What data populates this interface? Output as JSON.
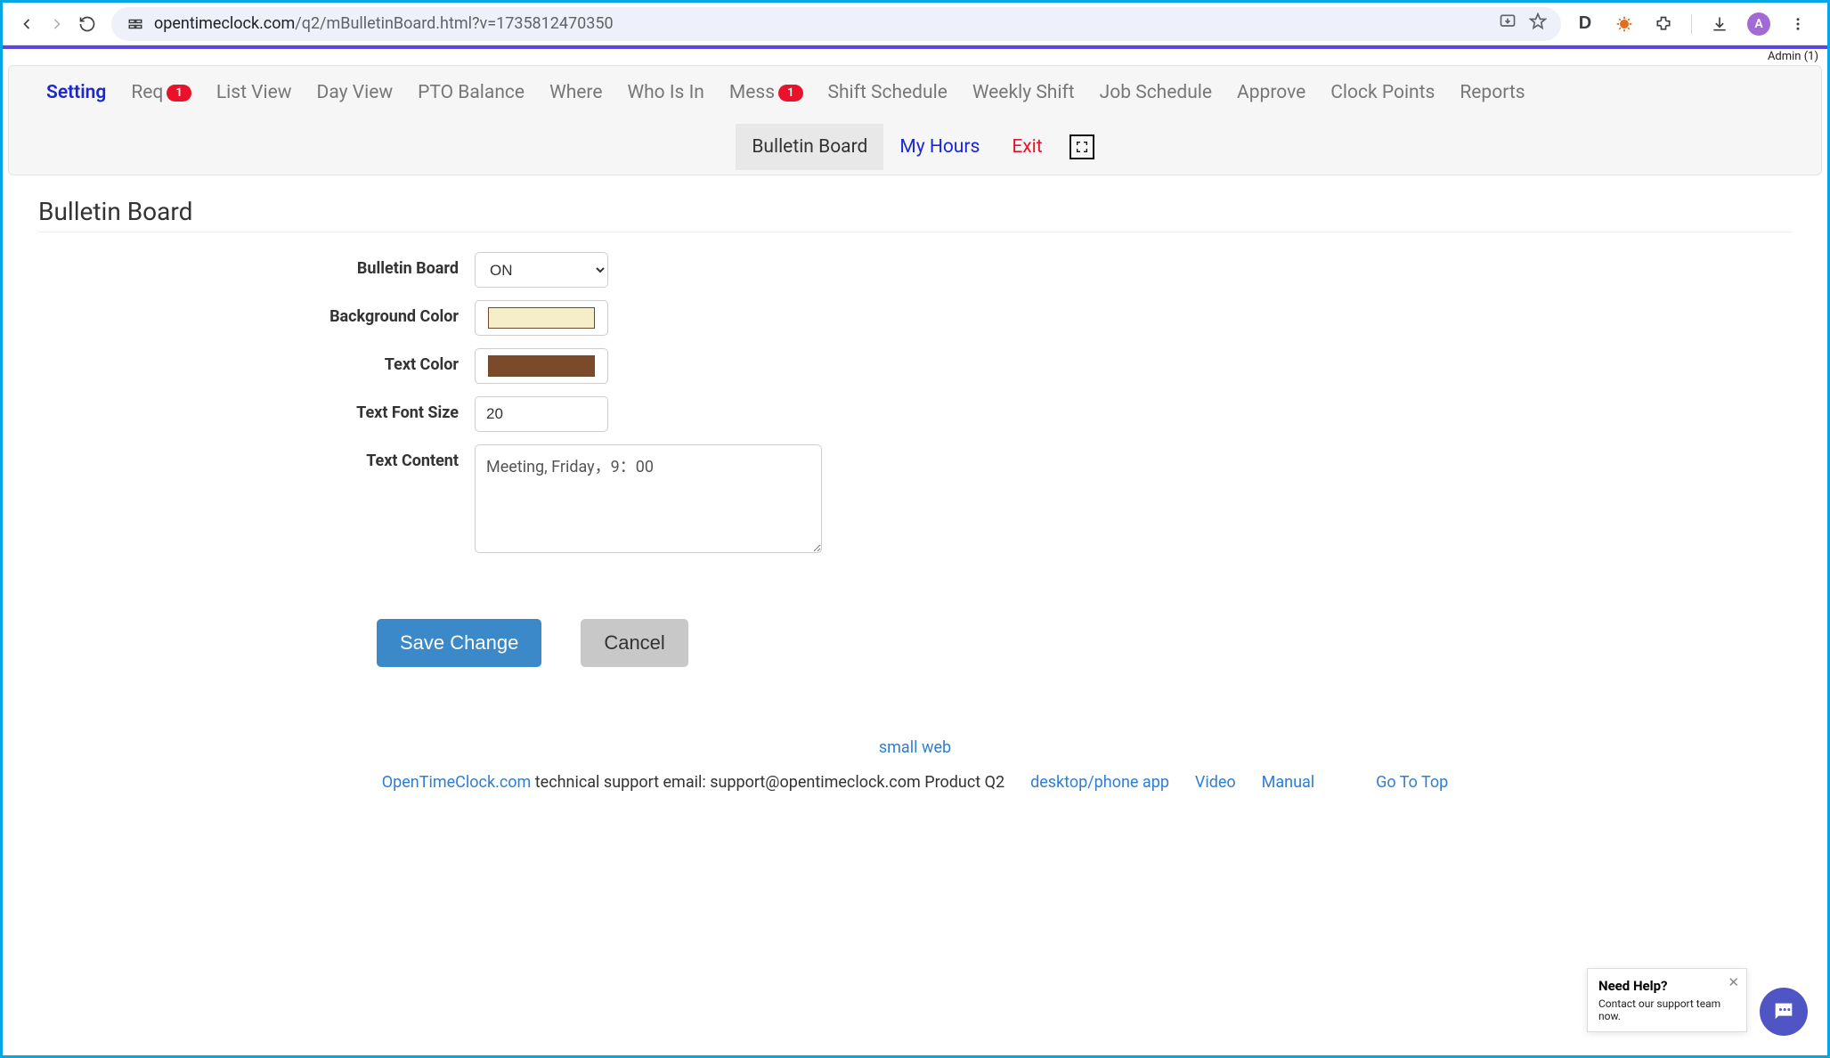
{
  "browser": {
    "url_host": "opentimeclock.com",
    "url_rest": "/q2/mBulletinBoard.html?v=1735812470350",
    "avatar_initial": "A",
    "ext_d": "D"
  },
  "top_user_label": "Admin (1)",
  "nav": {
    "setting": "Setting",
    "req": "Req",
    "req_badge": "1",
    "list_view": "List View",
    "day_view": "Day View",
    "pto_balance": "PTO Balance",
    "where": "Where",
    "who_is_in": "Who Is In",
    "mess": "Mess",
    "mess_badge": "1",
    "shift_schedule": "Shift Schedule",
    "weekly_shift": "Weekly Shift",
    "job_schedule": "Job Schedule",
    "approve": "Approve",
    "clock_points": "Clock Points",
    "reports": "Reports"
  },
  "subnav": {
    "bulletin_board": "Bulletin Board",
    "my_hours": "My Hours",
    "exit": "Exit"
  },
  "page": {
    "title": "Bulletin Board",
    "labels": {
      "bulletin_board": "Bulletin Board",
      "background_color": "Background Color",
      "text_color": "Text Color",
      "text_font_size": "Text Font Size",
      "text_content": "Text Content"
    },
    "values": {
      "toggle": "ON",
      "bg_color": "#f5eec9",
      "text_color": "#7a4a2a",
      "font_size": "20",
      "content": "Meeting, Friday，9：00"
    },
    "buttons": {
      "save": "Save Change",
      "cancel": "Cancel"
    }
  },
  "footer": {
    "small_web": "small web",
    "site": "OpenTimeClock.com",
    "support_text": " technical support email: support@opentimeclock.com Product Q2",
    "desktop": "desktop/phone app",
    "video": "Video",
    "manual": "Manual",
    "go_top": "Go To Top"
  },
  "help": {
    "title": "Need Help?",
    "subtitle": "Contact our support team now."
  }
}
